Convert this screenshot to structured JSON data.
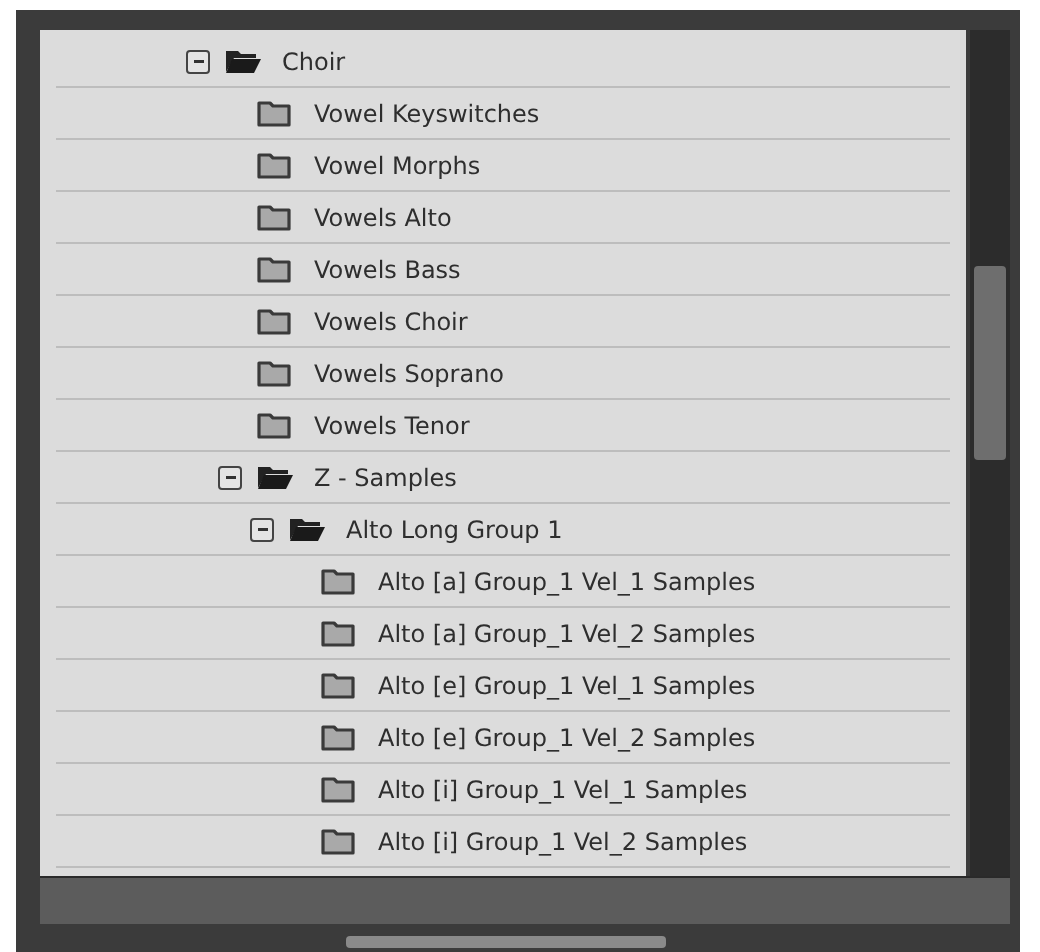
{
  "tree": [
    {
      "label": "Choir",
      "expanded": true,
      "children": [
        {
          "label": "Vowel Keyswitches"
        },
        {
          "label": "Vowel Morphs"
        },
        {
          "label": "Vowels Alto"
        },
        {
          "label": "Vowels Bass"
        },
        {
          "label": "Vowels Choir"
        },
        {
          "label": "Vowels Soprano"
        },
        {
          "label": "Vowels Tenor"
        },
        {
          "label": "Z - Samples",
          "expanded": true,
          "children": [
            {
              "label": "Alto Long Group 1",
              "expanded": true,
              "children": [
                {
                  "label": "Alto [a] Group_1 Vel_1 Samples"
                },
                {
                  "label": "Alto [a] Group_1 Vel_2 Samples"
                },
                {
                  "label": "Alto [e] Group_1 Vel_1 Samples"
                },
                {
                  "label": "Alto [e] Group_1 Vel_2 Samples"
                },
                {
                  "label": "Alto [i] Group_1 Vel_1 Samples"
                },
                {
                  "label": "Alto [i] Group_1 Vel_2 Samples"
                }
              ]
            }
          ]
        }
      ]
    }
  ]
}
